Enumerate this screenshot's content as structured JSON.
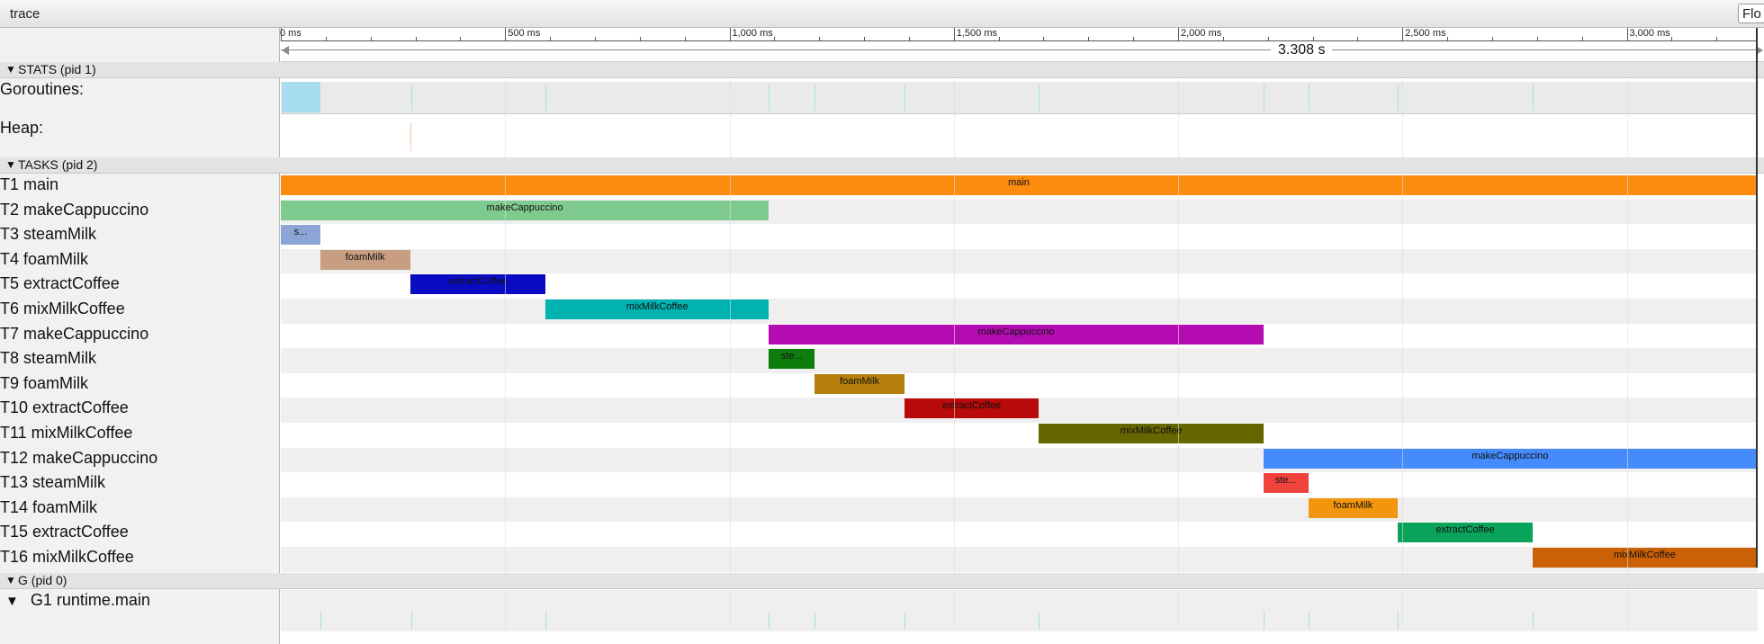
{
  "window": {
    "title": "trace",
    "filter_placeholder": "Flo"
  },
  "ruler": {
    "ticks": [
      "0 ms",
      "500 ms",
      "1,000 ms",
      "1,500 ms",
      "2,000 ms",
      "2,500 ms",
      "3,000 ms"
    ],
    "span_label": "3.308 s"
  },
  "sections": {
    "stats": "STATS (pid 1)",
    "tasks": "TASKS (pid 2)",
    "g": "G (pid 0)"
  },
  "stats_rows": {
    "goroutines": "Goroutines:",
    "heap": "Heap:"
  },
  "tasks": [
    {
      "label": "T1 main",
      "bar": "main",
      "color": "#fb8c0e"
    },
    {
      "label": "T2 makeCappuccino",
      "bar": "makeCappuccino",
      "color": "#7fca8f"
    },
    {
      "label": "T3 steamMilk",
      "bar": "s...",
      "color": "#8ca4d6"
    },
    {
      "label": "T4 foamMilk",
      "bar": "foamMilk",
      "color": "#c89e82"
    },
    {
      "label": "T5 extractCoffee",
      "bar": "extractCoffee",
      "color": "#0b0bc3"
    },
    {
      "label": "T6 mixMilkCoffee",
      "bar": "mixMilkCoffee",
      "color": "#00b2b2"
    },
    {
      "label": "T7 makeCappuccino",
      "bar": "makeCappuccino",
      "color": "#b30cb3"
    },
    {
      "label": "T8 steamMilk",
      "bar": "ste...",
      "color": "#0d7d0d"
    },
    {
      "label": "T9 foamMilk",
      "bar": "foamMilk",
      "color": "#b5800e"
    },
    {
      "label": "T10 extractCoffee",
      "bar": "extractCoffee",
      "color": "#b80a0a"
    },
    {
      "label": "T11 mixMilkCoffee",
      "bar": "mixMilkCoffee",
      "color": "#666600"
    },
    {
      "label": "T12 makeCappuccino",
      "bar": "makeCappuccino",
      "color": "#458bfb"
    },
    {
      "label": "T13 steamMilk",
      "bar": "ste...",
      "color": "#f0433d"
    },
    {
      "label": "T14 foamMilk",
      "bar": "foamMilk",
      "color": "#f2960e"
    },
    {
      "label": "T15 extractCoffee",
      "bar": "extractCoffee",
      "color": "#0aa35a"
    },
    {
      "label": "T16 mixMilkCoffee",
      "bar": "mixMilkCoffee",
      "color": "#cc6007"
    }
  ],
  "g_rows": {
    "g1": "G1 runtime.main"
  }
}
